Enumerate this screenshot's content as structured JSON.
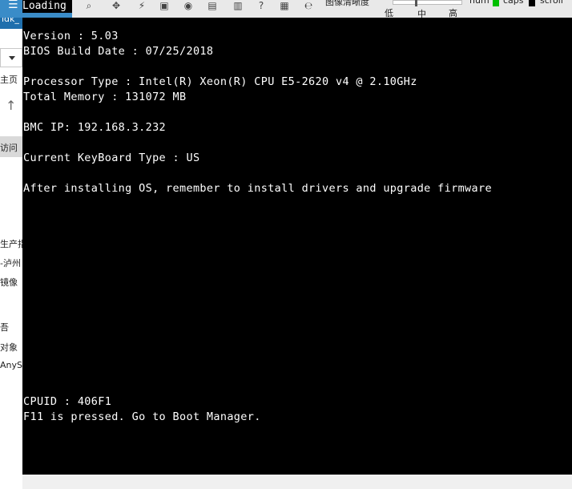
{
  "left_panel": {
    "title": "ldk_",
    "labels": [
      "主页",
      "访问",
      "生产指",
      "-泸州",
      "镜像",
      "吾",
      "对象",
      "AnyS"
    ]
  },
  "header": {
    "loading": "Loading"
  },
  "toolbar": {
    "image_quality_label": "图像清晰度",
    "quality_low": "低",
    "quality_mid": "中",
    "quality_high": "高",
    "num_label": "num",
    "caps_label": "caps",
    "scroll_label": "scroll",
    "num_color": "#00c000",
    "caps_color": "#000000"
  },
  "console": {
    "lines": [
      "Version : 5.03",
      "BIOS Build Date : 07/25/2018",
      "Processor Type : Intel(R) Xeon(R) CPU E5-2620 v4 @ 2.10GHz",
      "Total Memory : 131072 MB",
      "BMC IP: 192.168.3.232",
      "Current KeyBoard Type : US",
      "After installing OS, remember to install drivers and upgrade firmware",
      "CPUID : 406F1",
      "F11 is pressed. Go to Boot Manager."
    ]
  }
}
